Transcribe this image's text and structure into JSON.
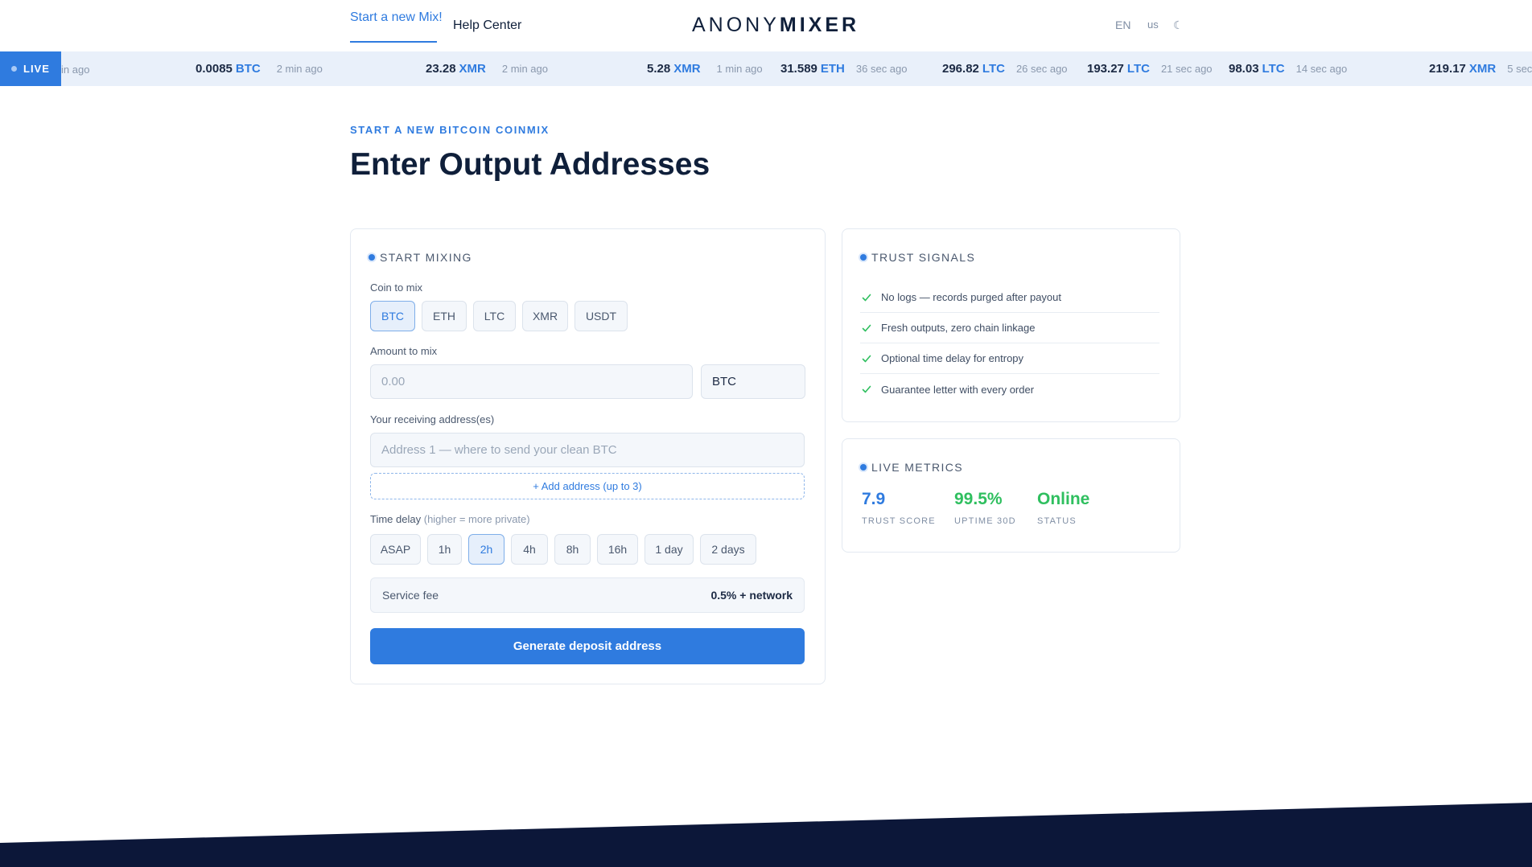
{
  "colors": {
    "accent": "#2f7bdf",
    "success": "#2fbf5f",
    "navy": "#0c1739",
    "ticker_bg": "#e9f0fa"
  },
  "nav": {
    "start_mix": "Start a new Mix!",
    "help_center": "Help Center",
    "logo_light": "ANONY",
    "logo_bold": "MIXER",
    "lang": "EN",
    "region": "us",
    "theme_glyph": "☾"
  },
  "ticker": {
    "live_label": "LIVE",
    "partial_time": "in ago",
    "items": [
      {
        "amount": "0.0085",
        "coin": "BTC",
        "time": "2 min ago"
      },
      {
        "amount": "23.28",
        "coin": "XMR",
        "time": "2 min ago"
      },
      {
        "amount": "5.28",
        "coin": "XMR",
        "time": "1 min ago"
      },
      {
        "amount": "31.589",
        "coin": "ETH",
        "time": "36 sec ago"
      },
      {
        "amount": "296.82",
        "coin": "LTC",
        "time": "26 sec ago"
      },
      {
        "amount": "193.27",
        "coin": "LTC",
        "time": "21 sec ago"
      },
      {
        "amount": "98.03",
        "coin": "LTC",
        "time": "14 sec ago"
      },
      {
        "amount": "219.17",
        "coin": "XMR",
        "time": "5 sec"
      }
    ]
  },
  "page": {
    "eyebrow": "START A NEW BITCOIN COINMIX",
    "title": "Enter Output Addresses"
  },
  "mix_form": {
    "heading": "START MIXING",
    "coin_label": "Coin to mix",
    "coins": [
      "BTC",
      "ETH",
      "LTC",
      "XMR",
      "USDT"
    ],
    "selected_coin": "BTC",
    "amount_label": "Amount to mix",
    "amount_placeholder": "0.00",
    "amount_unit": "BTC",
    "address_label": "Your receiving address(es)",
    "address_placeholder": "Address 1 — where to send your clean BTC",
    "add_address": "+ Add address (up to 3)",
    "delay_label": "Time delay",
    "delay_hint": "(higher = more private)",
    "delays": [
      "ASAP",
      "1h",
      "2h",
      "4h",
      "8h",
      "16h",
      "1 day",
      "2 days"
    ],
    "selected_delay": "2h",
    "fee_label": "Service fee",
    "fee_value": "0.5% + network",
    "submit": "Generate deposit address"
  },
  "trust": {
    "heading": "TRUST SIGNALS",
    "items": [
      "No logs — records purged after payout",
      "Fresh outputs, zero chain linkage",
      "Optional time delay for entropy",
      "Guarantee letter with every order"
    ]
  },
  "metrics": {
    "heading": "LIVE METRICS",
    "trust_score": {
      "value": "7.9",
      "label": "TRUST SCORE"
    },
    "uptime": {
      "value": "99.5%",
      "label": "UPTIME 30D"
    },
    "status": {
      "value": "Online",
      "label": "STATUS"
    }
  }
}
